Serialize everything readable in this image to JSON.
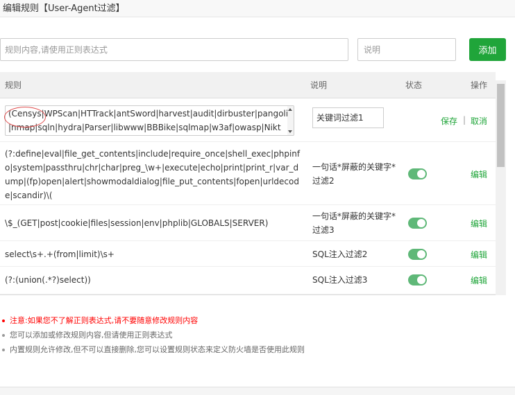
{
  "dialog": {
    "title": "编辑规则【User-Agent过滤】"
  },
  "add_form": {
    "rule_placeholder": "规则内容,请使用正则表达式",
    "desc_placeholder": "说明",
    "add_label": "添加"
  },
  "table": {
    "headers": {
      "rule": "规则",
      "desc": "说明",
      "status": "状态",
      "action": "操作"
    },
    "editing_row": {
      "rule_value": "(Censys|WPScan|HTTrack|antSword|harvest|audit|dirbuster|pangolin|nmap|sqln|hydra|Parser|libwww|BBBike|sqlmap|w3af|owasp|Nikt",
      "desc_value": "关键词过滤1",
      "save_label": "保存",
      "separator": "|",
      "cancel_label": "取消"
    },
    "rows": [
      {
        "rule": "(?:define|eval|file_get_contents|include|require_once|shell_exec|phpinfo|system|passthru|chr|char|preg_\\w+|execute|echo|print|print_r|var_dump|(fp)open|alert|showmodaldialog|file_put_contents|fopen|urldecode|scandir)\\(",
        "desc": "一句话*屏蔽的关键字*过滤2",
        "enabled": true,
        "edit_label": "编辑"
      },
      {
        "rule": "\\$_(GET|post|cookie|files|session|env|phplib|GLOBALS|SERVER)",
        "desc": "一句话*屏蔽的关键字*过滤3",
        "enabled": true,
        "edit_label": "编辑"
      },
      {
        "rule": "select\\s+.+(from|limit)\\s+",
        "desc": "SQL注入过滤2",
        "enabled": true,
        "edit_label": "编辑"
      },
      {
        "rule": "(?:(union(.*?)select))",
        "desc": "SQL注入过滤3",
        "enabled": true,
        "edit_label": "编辑"
      }
    ]
  },
  "notes": [
    "注意:如果您不了解正则表达式,请不要随意修改规则内容",
    "您可以添加或修改规则内容,但请使用正则表达式",
    "内置规则允许修改,但不可以直接删除,您可以设置规则状态来定义防火墙是否使用此规则"
  ],
  "colors": {
    "accent": "#20a53a",
    "toggle_on": "#5fb878",
    "warning": "#ff0000"
  }
}
